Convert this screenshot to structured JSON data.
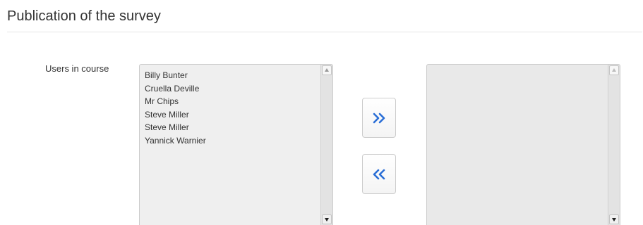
{
  "section": {
    "title": "Publication of the survey"
  },
  "field": {
    "label": "Users in course"
  },
  "users_available": [
    "Billy Bunter",
    "Cruella Deville",
    "Mr Chips",
    "Steve Miller",
    "Steve Miller",
    "Yannick Warnier"
  ],
  "users_selected": [],
  "buttons": {
    "add_icon": "double-chevron-right-icon",
    "remove_icon": "double-chevron-left-icon",
    "icon_color": "#2a6ed6"
  }
}
